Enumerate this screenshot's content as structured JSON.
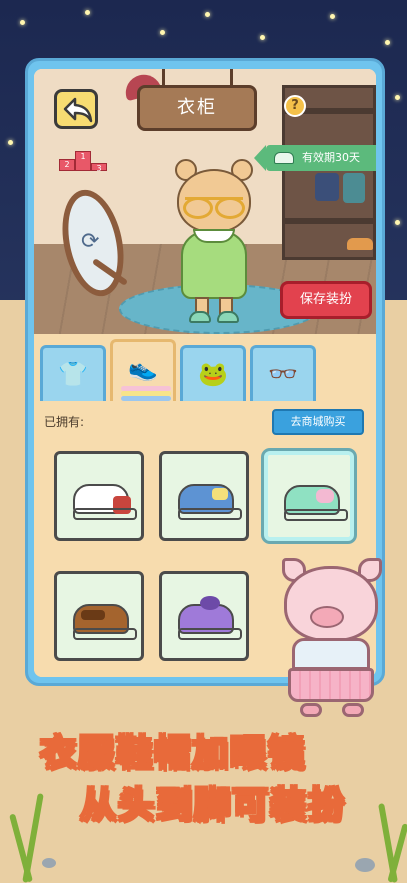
{
  "header": {
    "title": "衣柜",
    "back_label": "返回",
    "help_label": "?",
    "validity_label": "有效期30天",
    "podium_ranks": [
      "2",
      "1",
      "3"
    ]
  },
  "actions": {
    "save_label": "保存装扮"
  },
  "tabs": [
    {
      "icon": "shirt-icon",
      "glyph": "👕",
      "active": false
    },
    {
      "icon": "shoe-icon",
      "glyph": "👟",
      "active": true
    },
    {
      "icon": "headband-icon",
      "glyph": "🐸",
      "active": false
    },
    {
      "icon": "glasses-icon",
      "glyph": "👓",
      "active": false
    }
  ],
  "inventory": {
    "owned_label": "已拥有:",
    "shop_label": "去商城购买",
    "items": [
      {
        "name": "red-white-sneaker",
        "color": "#ffffff",
        "accent": "#c8453d",
        "selected": false
      },
      {
        "name": "blue-slip-on",
        "color": "#5d93d3",
        "accent": "#f4e07a",
        "selected": false
      },
      {
        "name": "mint-shoe",
        "color": "#8fe1c2",
        "accent": "#f3b9d2",
        "selected": true
      },
      {
        "name": "brown-loafer",
        "color": "#a4642e",
        "accent": "#6a3a16",
        "selected": false
      },
      {
        "name": "purple-bow-shoe",
        "color": "#9f7ad9",
        "accent": "#6d4aa8",
        "selected": false
      }
    ]
  },
  "slogan": {
    "line1": "衣服鞋帽加眼镜",
    "line2": "从头到脚可装扮"
  },
  "colors": {
    "frame": "#6fc4ee",
    "save_button": "#e2424e",
    "shop_button": "#3aa1de",
    "validity_badge": "#5cba7c",
    "slogan_outline": "#e86a3a"
  }
}
